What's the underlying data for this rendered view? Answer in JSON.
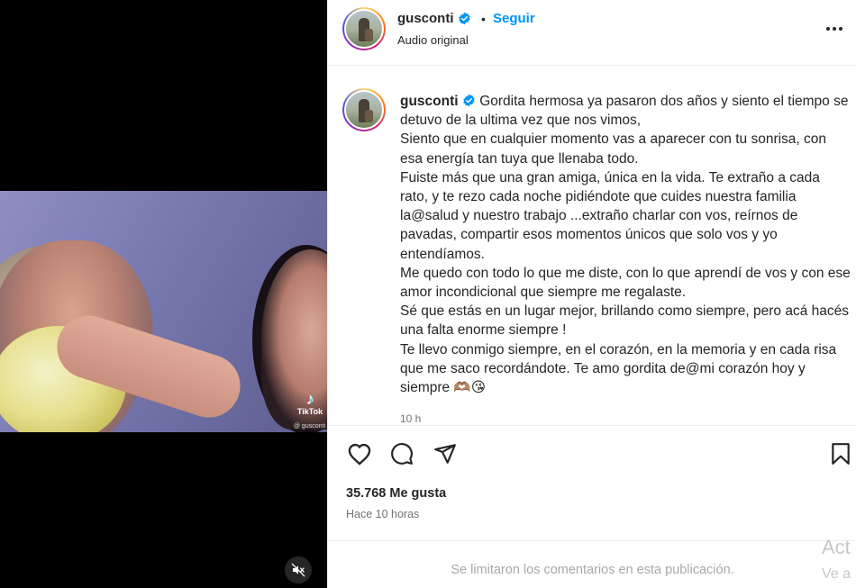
{
  "video": {
    "tiktok_label": "TikTok",
    "tiktok_user": "@ gusconti"
  },
  "header": {
    "username": "gusconti",
    "separator": "•",
    "follow_label": "Seguir",
    "audio": "Audio original"
  },
  "caption": {
    "username": "gusconti",
    "lines": [
      "Gordita hermosa ya pasaron dos años y siento el tiempo se detuvo de la ultima vez que nos vimos,",
      "Siento que en cualquier momento vas a aparecer con tu sonrisa, con esa energía tan tuya que llenaba todo.",
      "Fuiste más que una gran amiga, única en la vida. Te extraño a cada rato, y te rezo cada noche pidiéndote que cuides nuestra familia la@salud y nuestro trabajo ...extraño charlar con vos, reírnos de pavadas, compartir esos momentos únicos que solo vos y yo entendíamos.",
      "Me quedo con todo lo que me diste, con lo que aprendí de vos y con ese amor incondicional que siempre me regalaste.",
      "Sé que estás en un lugar mejor, brillando como siempre, pero acá hacés una falta enorme siempre !",
      "Te llevo conmigo siempre, en el corazón, en la memoria y en cada risa que me saco recordándote. Te amo gordita de@mi corazón hoy y siempre 🫶🏽😘"
    ],
    "time_ago": "10 h"
  },
  "actions": {
    "like_icon": "heart-icon",
    "comment_icon": "comment-icon",
    "share_icon": "paper-plane-icon",
    "save_icon": "bookmark-icon"
  },
  "likes": "35.768 Me gusta",
  "posted": "Hace 10 horas",
  "comments_off": "Se limitaron los comentarios en esta publicación.",
  "watermark": {
    "line1": "Act",
    "line2": "Ve a"
  },
  "colors": {
    "accent": "#0095f6",
    "verified": "#0095f6",
    "muted": "#737373"
  }
}
